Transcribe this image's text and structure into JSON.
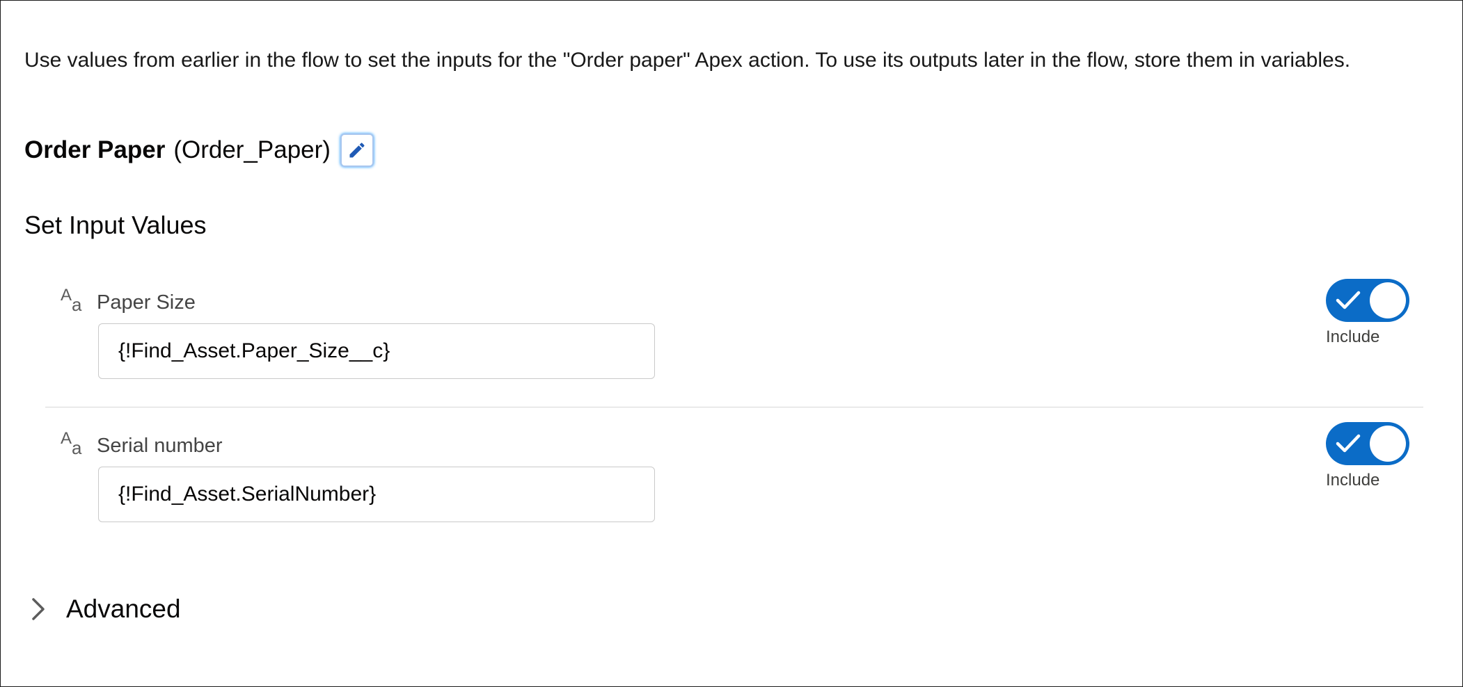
{
  "description": "Use values from earlier in the flow to set the inputs for the \"Order paper\" Apex action. To use its outputs later in the flow, store them in variables.",
  "action": {
    "label": "Order Paper",
    "api_name": "(Order_Paper)",
    "edit_icon": "pencil-icon"
  },
  "section_title": "Set Input Values",
  "inputs": [
    {
      "type_icon": "text-type-icon",
      "type_glyph_big": "A",
      "type_glyph_small": "a",
      "label": "Paper Size",
      "value": "{!Find_Asset.Paper_Size__c}",
      "include_label": "Include",
      "include": true
    },
    {
      "type_icon": "text-type-icon",
      "type_glyph_big": "A",
      "type_glyph_small": "a",
      "label": "Serial number",
      "value": "{!Find_Asset.SerialNumber}",
      "include_label": "Include",
      "include": true
    }
  ],
  "advanced": {
    "label": "Advanced",
    "icon": "chevron-right-icon",
    "expanded": false
  },
  "colors": {
    "toggle_on": "#0b6cc7",
    "text": "#080707",
    "border": "#c9c9c9"
  }
}
